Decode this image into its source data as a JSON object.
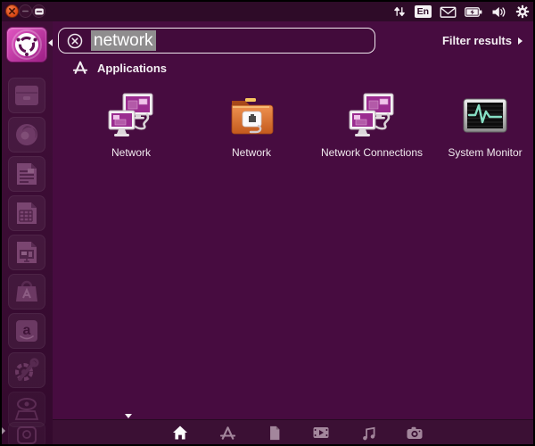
{
  "colors": {
    "panel_bg": "#2e0b28",
    "dash_bg": "#470c40",
    "launcher_bg": "#3c0d35",
    "lens_bar_bg": "#3b1034",
    "close_orange": "#d84715",
    "ubuntu_tile_magenta": "#c238a6",
    "selection_gray": "#8f8d8e",
    "folder_orange": "#d96b26",
    "monitor_screen_purple": "#9b2d90",
    "waveform_teal": "#86dfc4"
  },
  "top_panel": {
    "window_controls": [
      {
        "name": "close"
      },
      {
        "name": "minimize"
      },
      {
        "name": "maximize"
      }
    ],
    "keyboard_layout": "En",
    "tray_icons": [
      "updown-arrows",
      "keyboard-layout",
      "mail",
      "battery",
      "volume",
      "session-gear"
    ]
  },
  "dash": {
    "search": {
      "value": "network",
      "clear_icon": "circled-x"
    },
    "filter": {
      "label": "Filter results"
    },
    "section_header": {
      "label": "Applications",
      "icon": "applications-lens"
    },
    "results": [
      {
        "label": "Network",
        "icon": "network-monitors"
      },
      {
        "label": "Network",
        "icon": "network-folder"
      },
      {
        "label": "Network Connections",
        "icon": "network-monitors"
      },
      {
        "label": "System Monitor",
        "icon": "system-monitor"
      }
    ]
  },
  "launcher": {
    "items": [
      "ubuntu-dash",
      "files",
      "firefox",
      "libreoffice-writer",
      "libreoffice-calc",
      "libreoffice-impress",
      "software-center",
      "amazon",
      "system-settings",
      "workspace-switcher",
      "trash"
    ]
  },
  "lens_bar": {
    "lenses": [
      {
        "name": "home",
        "active": true
      },
      {
        "name": "applications",
        "active": false
      },
      {
        "name": "files",
        "active": false
      },
      {
        "name": "video",
        "active": false
      },
      {
        "name": "music",
        "active": false
      },
      {
        "name": "photos",
        "active": false
      }
    ]
  }
}
